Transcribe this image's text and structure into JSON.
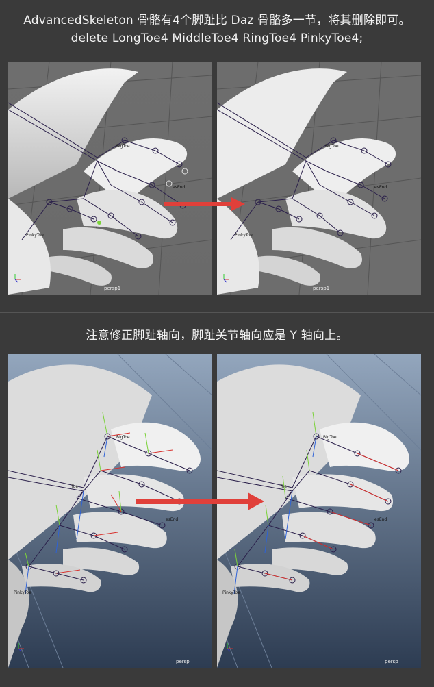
{
  "top_caption_line1": "AdvancedSkeleton 骨骼有4个脚趾比 Daz 骨骼多一节，将其删除即可。",
  "top_caption_line2": "delete LongToe4 MiddleToe4 RingToe4 PinkyToe4;",
  "bottom_caption": "注意修正脚趾轴向，脚趾关节轴向应是 Y 轴向上。",
  "viewports": {
    "top_left": {
      "camera": "persp1",
      "labels": [
        "BigToe",
        "PinkyToe",
        "esEnd"
      ]
    },
    "top_right": {
      "camera": "persp1",
      "labels": [
        "BigToe",
        "PinkyToe",
        "esEnd"
      ]
    },
    "bottom_left": {
      "camera": "persp",
      "labels": [
        "BigToe",
        "PinkyToe",
        "Toe",
        "esEnd"
      ]
    },
    "bottom_right": {
      "camera": "persp",
      "labels": [
        "BigToe",
        "PinkyToe",
        "Toe",
        "esEnd"
      ]
    }
  },
  "axis_letters": {
    "x": "X",
    "y": "Y",
    "z": "Z"
  },
  "colors": {
    "arrow": "#e0403a",
    "viewport_gray": "#6c6c6c",
    "viewport_blue_top": "#93a6bd",
    "viewport_blue_bottom": "#2d3c52",
    "joint_purple": "#2a1f4a",
    "axis_x": "#d8322f",
    "axis_y": "#7bd23a",
    "axis_z": "#2d62d8"
  }
}
